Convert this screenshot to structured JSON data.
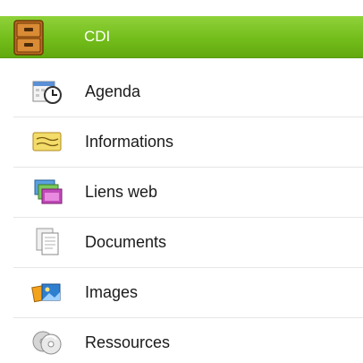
{
  "header": {
    "title": "CDI",
    "icon": "archive-cabinet-icon"
  },
  "items": [
    {
      "label": "Agenda",
      "icon": "calendar-clock-icon"
    },
    {
      "label": "Informations",
      "icon": "note-icon"
    },
    {
      "label": "Liens web",
      "icon": "web-links-icon"
    },
    {
      "label": "Documents",
      "icon": "documents-icon"
    },
    {
      "label": "Images",
      "icon": "images-icon"
    },
    {
      "label": "Ressources",
      "icon": "cd-disc-icon"
    }
  ],
  "colors": {
    "header_green": "#73bd1b",
    "header_text": "#ffffff"
  }
}
